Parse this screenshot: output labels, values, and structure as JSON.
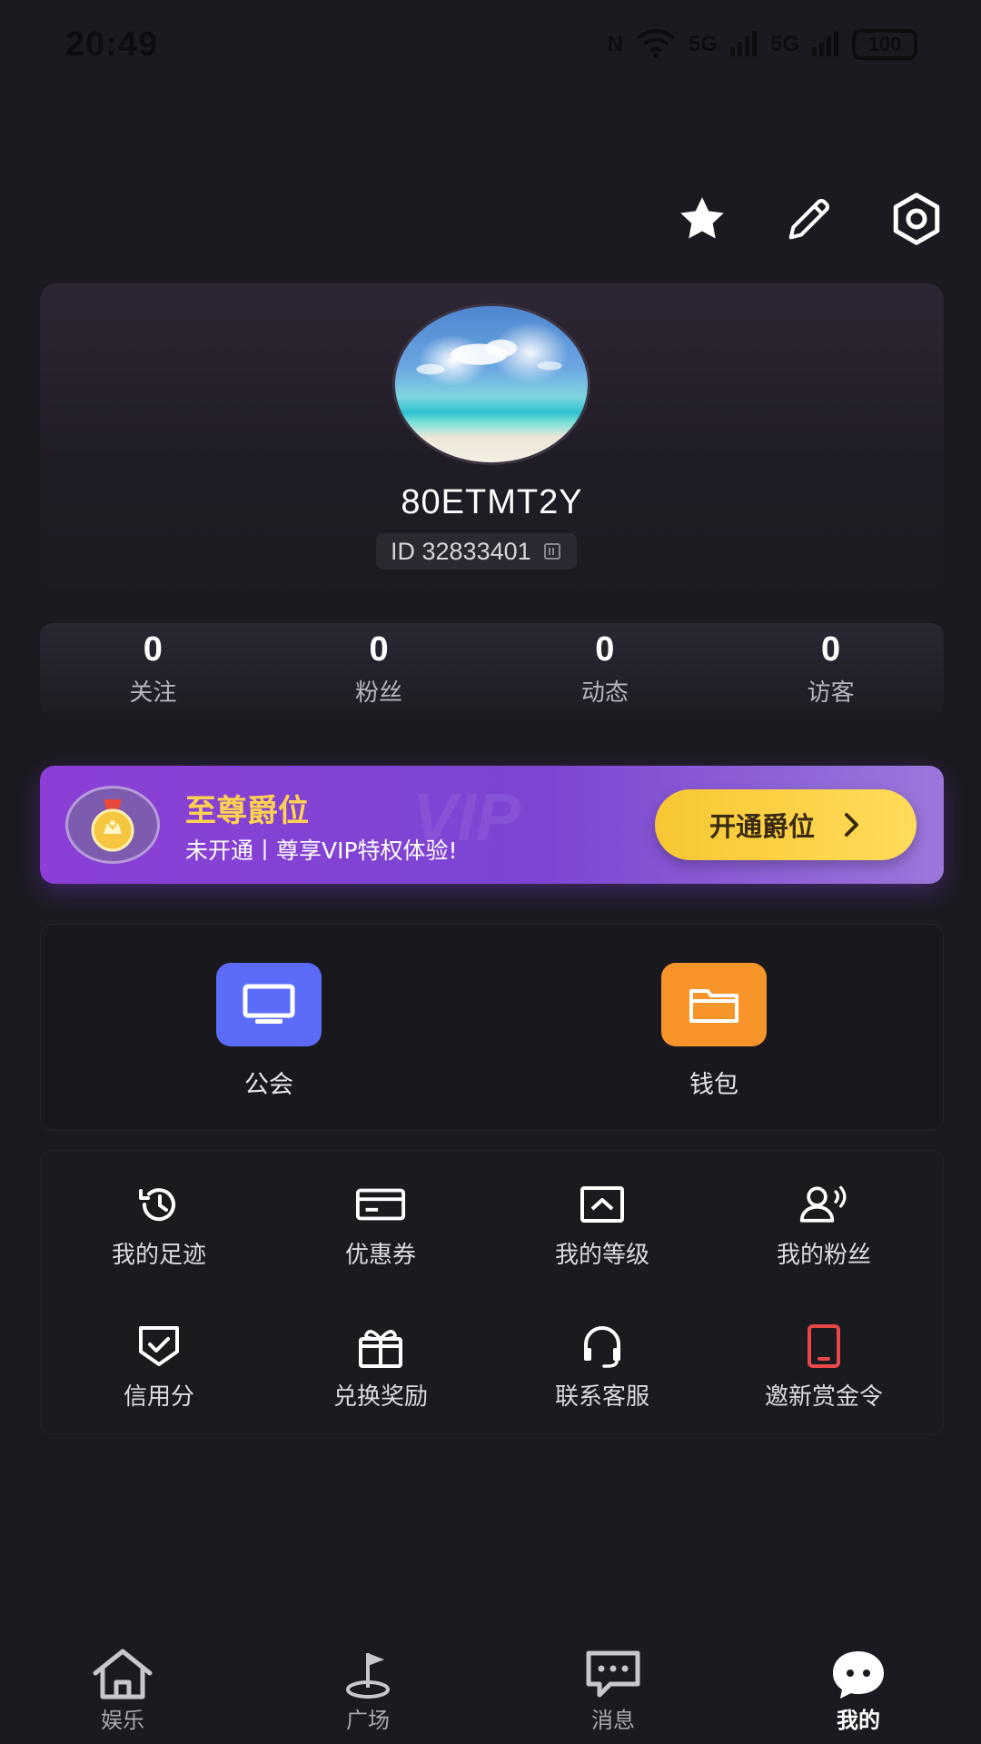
{
  "status_bar": {
    "time": "20:49",
    "nfc": "N",
    "signal_1": "5G",
    "signal_2": "5G",
    "battery": "100"
  },
  "profile": {
    "username": "80ETMT2Y",
    "id_text": "ID 32833401"
  },
  "stats": [
    {
      "value": "0",
      "label": "关注"
    },
    {
      "value": "0",
      "label": "粉丝"
    },
    {
      "value": "0",
      "label": "动态"
    },
    {
      "value": "0",
      "label": "访客"
    }
  ],
  "vip": {
    "title": "至尊爵位",
    "subtitle": "未开通丨尊享VIP特权体验!",
    "button_label": "开通爵位",
    "watermark": "VIP"
  },
  "quick_actions": [
    {
      "label": "公会",
      "color": "#5b6df8",
      "icon": "monitor-icon"
    },
    {
      "label": "钱包",
      "color": "#f7952b",
      "icon": "folder-icon"
    }
  ],
  "services": [
    {
      "label": "我的足迹",
      "icon": "history-icon"
    },
    {
      "label": "优惠券",
      "icon": "coupon-icon"
    },
    {
      "label": "我的等级",
      "icon": "level-icon"
    },
    {
      "label": "我的粉丝",
      "icon": "fans-icon"
    },
    {
      "label": "信用分",
      "icon": "credit-shield-icon"
    },
    {
      "label": "兑换奖励",
      "icon": "gift-icon"
    },
    {
      "label": "联系客服",
      "icon": "headset-icon"
    },
    {
      "label": "邀新赏金令",
      "icon": "phone-icon",
      "color": "#e8464a"
    }
  ],
  "tabbar": [
    {
      "label": "娱乐",
      "icon": "home-icon",
      "active": false
    },
    {
      "label": "广场",
      "icon": "golf-flag-icon",
      "active": false
    },
    {
      "label": "消息",
      "icon": "message-icon",
      "active": false
    },
    {
      "label": "我的",
      "icon": "me-bubble-icon",
      "active": true
    }
  ]
}
